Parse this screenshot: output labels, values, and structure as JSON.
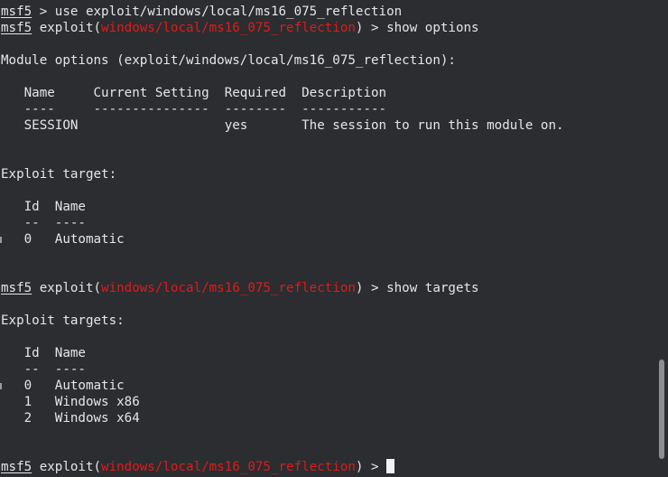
{
  "terminal": {
    "lines": [
      {
        "segments": [
          {
            "text": "msf5",
            "style": "u"
          },
          {
            "text": " > use exploit/windows/local/ms16_075_reflection"
          }
        ]
      },
      {
        "segments": [
          {
            "text": "msf5",
            "style": "u"
          },
          {
            "text": " exploit("
          },
          {
            "text": "windows/local/ms16_075_reflection",
            "style": "red"
          },
          {
            "text": ") > show options"
          }
        ]
      },
      {
        "segments": [
          {
            "text": ""
          }
        ]
      },
      {
        "segments": [
          {
            "text": "Module options (exploit/windows/local/ms16_075_reflection):"
          }
        ]
      },
      {
        "segments": [
          {
            "text": ""
          }
        ]
      },
      {
        "segments": [
          {
            "text": "   Name     Current Setting  Required  Description"
          }
        ]
      },
      {
        "segments": [
          {
            "text": "   ----     ---------------  --------  -----------"
          }
        ]
      },
      {
        "segments": [
          {
            "text": "   SESSION                   yes       The session to run this module on."
          }
        ]
      },
      {
        "segments": [
          {
            "text": ""
          }
        ]
      },
      {
        "segments": [
          {
            "text": ""
          }
        ]
      },
      {
        "segments": [
          {
            "text": "Exploit target:"
          }
        ]
      },
      {
        "segments": [
          {
            "text": ""
          }
        ]
      },
      {
        "segments": [
          {
            "text": "   Id  Name"
          }
        ]
      },
      {
        "segments": [
          {
            "text": "   --  ----"
          }
        ]
      },
      {
        "segments": [
          {
            "text": "   0   Automatic"
          }
        ]
      },
      {
        "segments": [
          {
            "text": ""
          }
        ]
      },
      {
        "segments": [
          {
            "text": ""
          }
        ]
      },
      {
        "segments": [
          {
            "text": "msf5",
            "style": "u"
          },
          {
            "text": " exploit("
          },
          {
            "text": "windows/local/ms16_075_reflection",
            "style": "red"
          },
          {
            "text": ") > show targets"
          }
        ]
      },
      {
        "segments": [
          {
            "text": ""
          }
        ]
      },
      {
        "segments": [
          {
            "text": "Exploit targets:"
          }
        ]
      },
      {
        "segments": [
          {
            "text": ""
          }
        ]
      },
      {
        "segments": [
          {
            "text": "   Id  Name"
          }
        ]
      },
      {
        "segments": [
          {
            "text": "   --  ----"
          }
        ]
      },
      {
        "segments": [
          {
            "text": "   0   Automatic"
          }
        ]
      },
      {
        "segments": [
          {
            "text": "   1   Windows x86"
          }
        ]
      },
      {
        "segments": [
          {
            "text": "   2   Windows x64"
          }
        ]
      },
      {
        "segments": [
          {
            "text": ""
          }
        ]
      },
      {
        "segments": [
          {
            "text": ""
          }
        ]
      },
      {
        "segments": [
          {
            "text": "msf5",
            "style": "u"
          },
          {
            "text": " exploit("
          },
          {
            "text": "windows/local/ms16_075_reflection",
            "style": "red"
          },
          {
            "text": ") > "
          }
        ],
        "cursor": true
      }
    ]
  },
  "colors": {
    "background": "#2b2d30",
    "foreground": "#e6e6e6",
    "module_path": "#e01b1b",
    "scrollbar_thumb": "#8c8e90"
  },
  "icons": {
    "cursor": "block-cursor-icon"
  }
}
